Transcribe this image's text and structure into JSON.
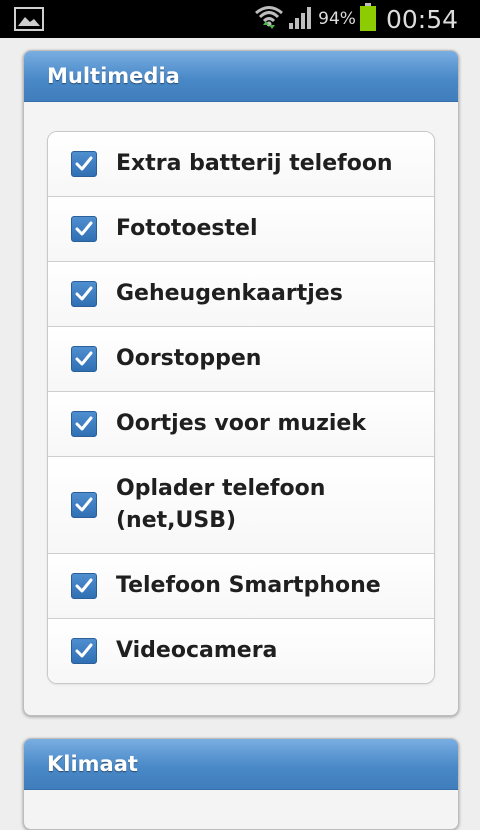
{
  "status_bar": {
    "battery_percent": "94%",
    "time": "00:54",
    "icons": [
      "image-notification-icon",
      "wifi-icon",
      "signal-icon",
      "battery-icon"
    ],
    "battery_color": "#8ccc00"
  },
  "sections": {
    "multimedia": {
      "title": "Multimedia",
      "items": [
        {
          "label": "Extra batterij telefoon",
          "checked": true
        },
        {
          "label": "Fototoestel",
          "checked": true
        },
        {
          "label": "Geheugenkaartjes",
          "checked": true
        },
        {
          "label": "Oorstoppen",
          "checked": true
        },
        {
          "label": "Oortjes voor muziek",
          "checked": true
        },
        {
          "label": "Oplader telefoon (net,USB)",
          "checked": true
        },
        {
          "label": "Telefoon Smartphone",
          "checked": true
        },
        {
          "label": "Videocamera",
          "checked": true
        }
      ]
    },
    "klimaat": {
      "title": "Klimaat"
    }
  },
  "colors": {
    "header_blue": "#4a89c8",
    "checkbox_blue": "#3f7dbd"
  }
}
